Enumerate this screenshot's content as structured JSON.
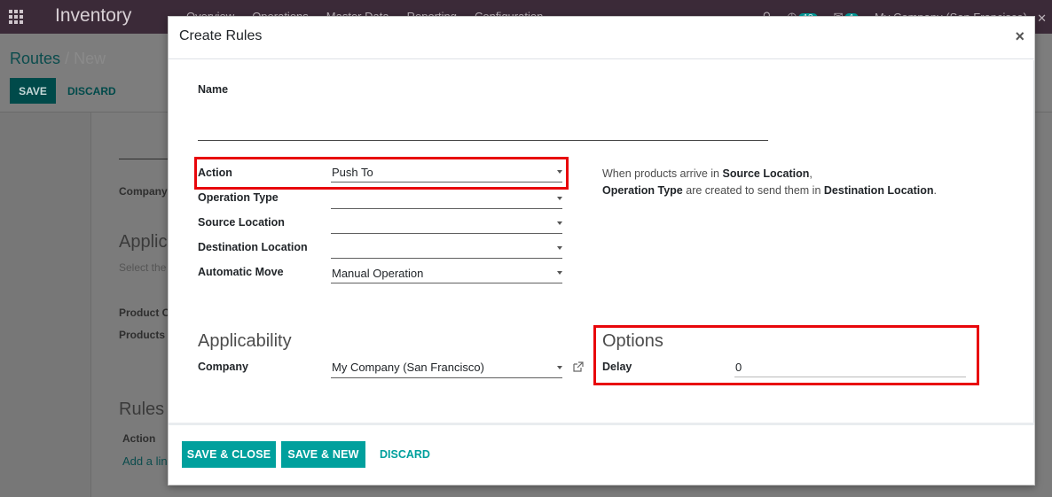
{
  "topbar": {
    "app_title": "Inventory",
    "menu": [
      "Overview",
      "Operations",
      "Master Data",
      "Reporting",
      "Configuration"
    ],
    "activity_count": "13",
    "message_count": "1",
    "company": "My Company (San Francisco)"
  },
  "background": {
    "breadcrumb_parent": "Routes",
    "breadcrumb_sep": "/",
    "breadcrumb_current": "New",
    "save_label": "SAVE",
    "discard_label": "DISCARD",
    "company_label": "Company",
    "applicability_title": "Applic",
    "select_hint": "Select the",
    "product_category_label": "Product C",
    "products_label": "Products",
    "rules_title": "Rules",
    "action_col": "Action",
    "add_line": "Add a lin"
  },
  "modal": {
    "title": "Create Rules",
    "close": "×",
    "name_label": "Name",
    "name_value": "",
    "action_label": "Action",
    "action_value": "Push To",
    "operation_type_label": "Operation Type",
    "operation_type_value": "",
    "source_location_label": "Source Location",
    "source_location_value": "",
    "destination_location_label": "Destination Location",
    "destination_location_value": "",
    "automatic_move_label": "Automatic Move",
    "automatic_move_value": "Manual Operation",
    "help": {
      "part1": "When products arrive in ",
      "bold1": "Source Location",
      "part2": ",",
      "bold2": "Operation Type",
      "part3": " are created to send them in ",
      "bold3": "Destination Location",
      "part4": "."
    },
    "applicability_title": "Applicability",
    "company_label": "Company",
    "company_value": "My Company (San Francisco)",
    "options_title": "Options",
    "delay_label": "Delay",
    "delay_value": "0",
    "footer": {
      "save_close": "SAVE & CLOSE",
      "save_new": "SAVE & NEW",
      "discard": "DISCARD"
    }
  },
  "colors": {
    "accent": "#00a09d",
    "highlight": "#e8060b",
    "topbar": "#3b2a38"
  }
}
